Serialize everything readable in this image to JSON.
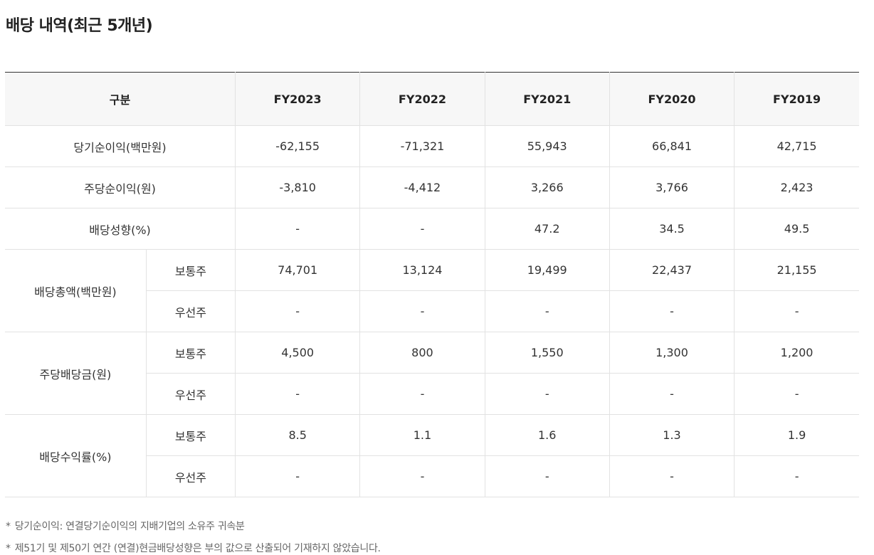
{
  "title": "배당 내역(최근 5개년)",
  "table": {
    "header_category": "구분",
    "years": [
      "FY2023",
      "FY2022",
      "FY2021",
      "FY2020",
      "FY2019"
    ],
    "rows": [
      {
        "category": "당기순이익(백만원)",
        "values": [
          "-62,155",
          "-71,321",
          "55,943",
          "66,841",
          "42,715"
        ]
      },
      {
        "category": "주당순이익(원)",
        "values": [
          "-3,810",
          "-4,412",
          "3,266",
          "3,766",
          "2,423"
        ]
      },
      {
        "category": "배당성향(%)",
        "values": [
          "-",
          "-",
          "47.2",
          "34.5",
          "49.5"
        ]
      }
    ],
    "groups": [
      {
        "category": "배당총액(백만원)",
        "subrows": [
          {
            "label": "보통주",
            "values": [
              "74,701",
              "13,124",
              "19,499",
              "22,437",
              "21,155"
            ]
          },
          {
            "label": "우선주",
            "values": [
              "-",
              "-",
              "-",
              "-",
              "-"
            ]
          }
        ]
      },
      {
        "category": "주당배당금(원)",
        "subrows": [
          {
            "label": "보통주",
            "values": [
              "4,500",
              "800",
              "1,550",
              "1,300",
              "1,200"
            ]
          },
          {
            "label": "우선주",
            "values": [
              "-",
              "-",
              "-",
              "-",
              "-"
            ]
          }
        ]
      },
      {
        "category": "배당수익률(%)",
        "subrows": [
          {
            "label": "보통주",
            "values": [
              "8.5",
              "1.1",
              "1.6",
              "1.3",
              "1.9"
            ]
          },
          {
            "label": "우선주",
            "values": [
              "-",
              "-",
              "-",
              "-",
              "-"
            ]
          }
        ]
      }
    ]
  },
  "notes": [
    {
      "mark": "*",
      "text": "당기순이익: 연결당기순이익의 지배기업의 소유주 귀속분"
    },
    {
      "mark": "*",
      "text": "제51기 및 제50기 연간 (연결)현금배당성향은 부의 값으로 산출되어 기재하지 않았습니다."
    }
  ]
}
